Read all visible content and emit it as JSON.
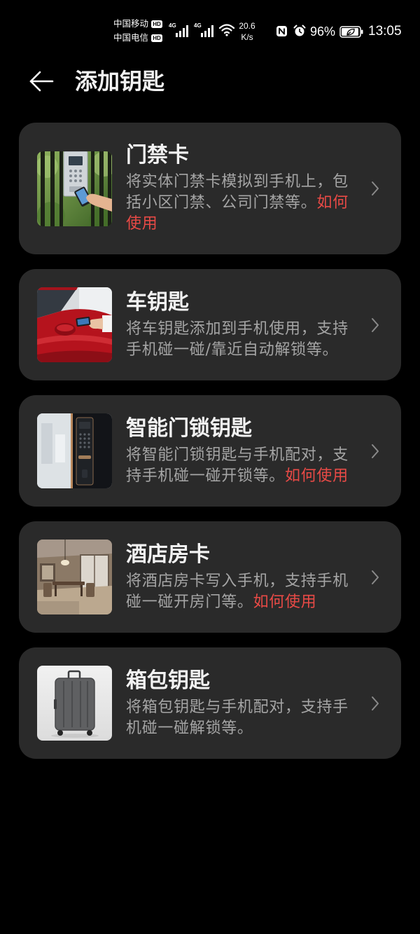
{
  "status_bar": {
    "carriers": [
      {
        "name": "中国移动",
        "badge": "HD"
      },
      {
        "name": "中国电信",
        "badge": "HD"
      }
    ],
    "signals": [
      {
        "network": "4G"
      },
      {
        "network": "4G"
      }
    ],
    "speed": {
      "value": "20.6",
      "unit": "K/s"
    },
    "battery_percent": "96%",
    "battery_level": 0.96,
    "time": "13:05",
    "icons": {
      "signal": "signal-bars-icon",
      "wifi": "wifi-icon",
      "nfc": "nfc-icon",
      "alarm": "alarm-icon",
      "battery": "battery-saver-icon"
    }
  },
  "header": {
    "back_icon": "back-arrow-icon",
    "title": "添加钥匙"
  },
  "key_types": [
    {
      "thumbnail": "door-access-photo",
      "title": "门禁卡",
      "description": "将实体门禁卡模拟到手机上，包括小区门禁、公司门禁等。",
      "link": "如何使用"
    },
    {
      "thumbnail": "car-key-photo",
      "title": "车钥匙",
      "description": "将车钥匙添加到手机使用，支持手机碰一碰/靠近自动解锁等。"
    },
    {
      "thumbnail": "smart-lock-photo",
      "title": "智能门锁钥匙",
      "description": "将智能门锁钥匙与手机配对，支持手机碰一碰开锁等。",
      "link": "如何使用"
    },
    {
      "thumbnail": "hotel-room-photo",
      "title": "酒店房卡",
      "description": "将酒店房卡写入手机，支持手机碰一碰开房门等。",
      "link": "如何使用"
    },
    {
      "thumbnail": "luggage-photo",
      "title": "箱包钥匙",
      "description": "将箱包钥匙与手机配对，支持手机碰一碰解锁等。"
    }
  ],
  "colors": {
    "background": "#000000",
    "card": "#2a2a2a",
    "title_text": "#f2f2f2",
    "description_text": "#a5a5a5",
    "link": "#e84a46",
    "chevron": "#8a8a8a",
    "status_text": "#ffffff"
  }
}
